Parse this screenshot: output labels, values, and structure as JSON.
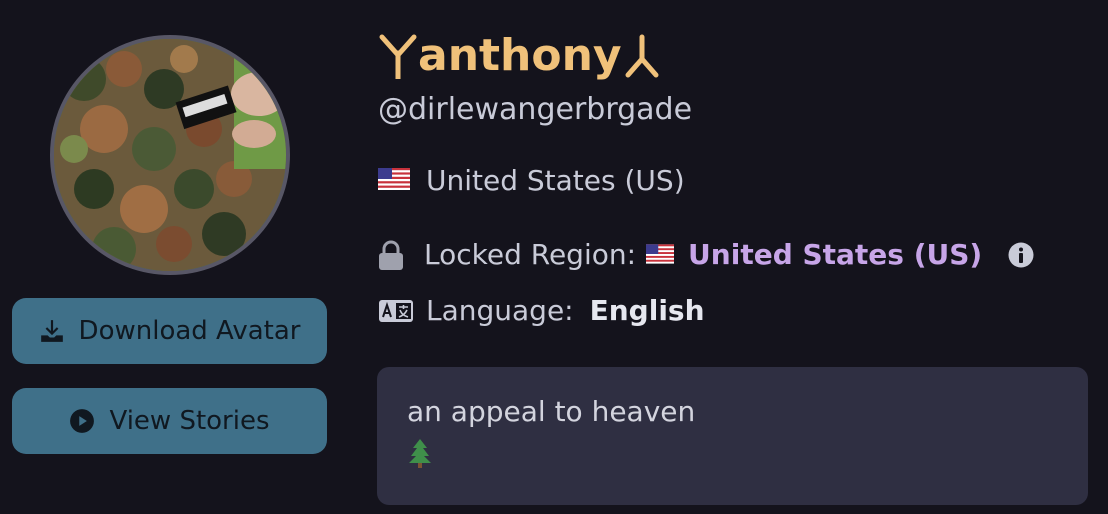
{
  "profile": {
    "display_name": "anthony",
    "username": "@dirlewangerbrgade",
    "country": "United States (US)",
    "locked_region_label": "Locked Region:",
    "locked_region_value": "United States (US)",
    "language_label": "Language:",
    "language_value": "English",
    "bio": "an appeal to heaven"
  },
  "actions": {
    "download_avatar": "Download Avatar",
    "view_stories": "View Stories"
  },
  "icons": {
    "download": "download-icon",
    "play": "play-circle-icon",
    "lock": "lock-icon",
    "info": "info-circle-icon",
    "language": "language-icon",
    "flag": "us-flag-icon",
    "tree": "evergreen-tree-icon"
  },
  "colors": {
    "background": "#14131c",
    "accent_name": "#f0c17a",
    "button": "#3f7089",
    "region_link": "#c7a5e8",
    "bio_box": "#2f2f42"
  }
}
